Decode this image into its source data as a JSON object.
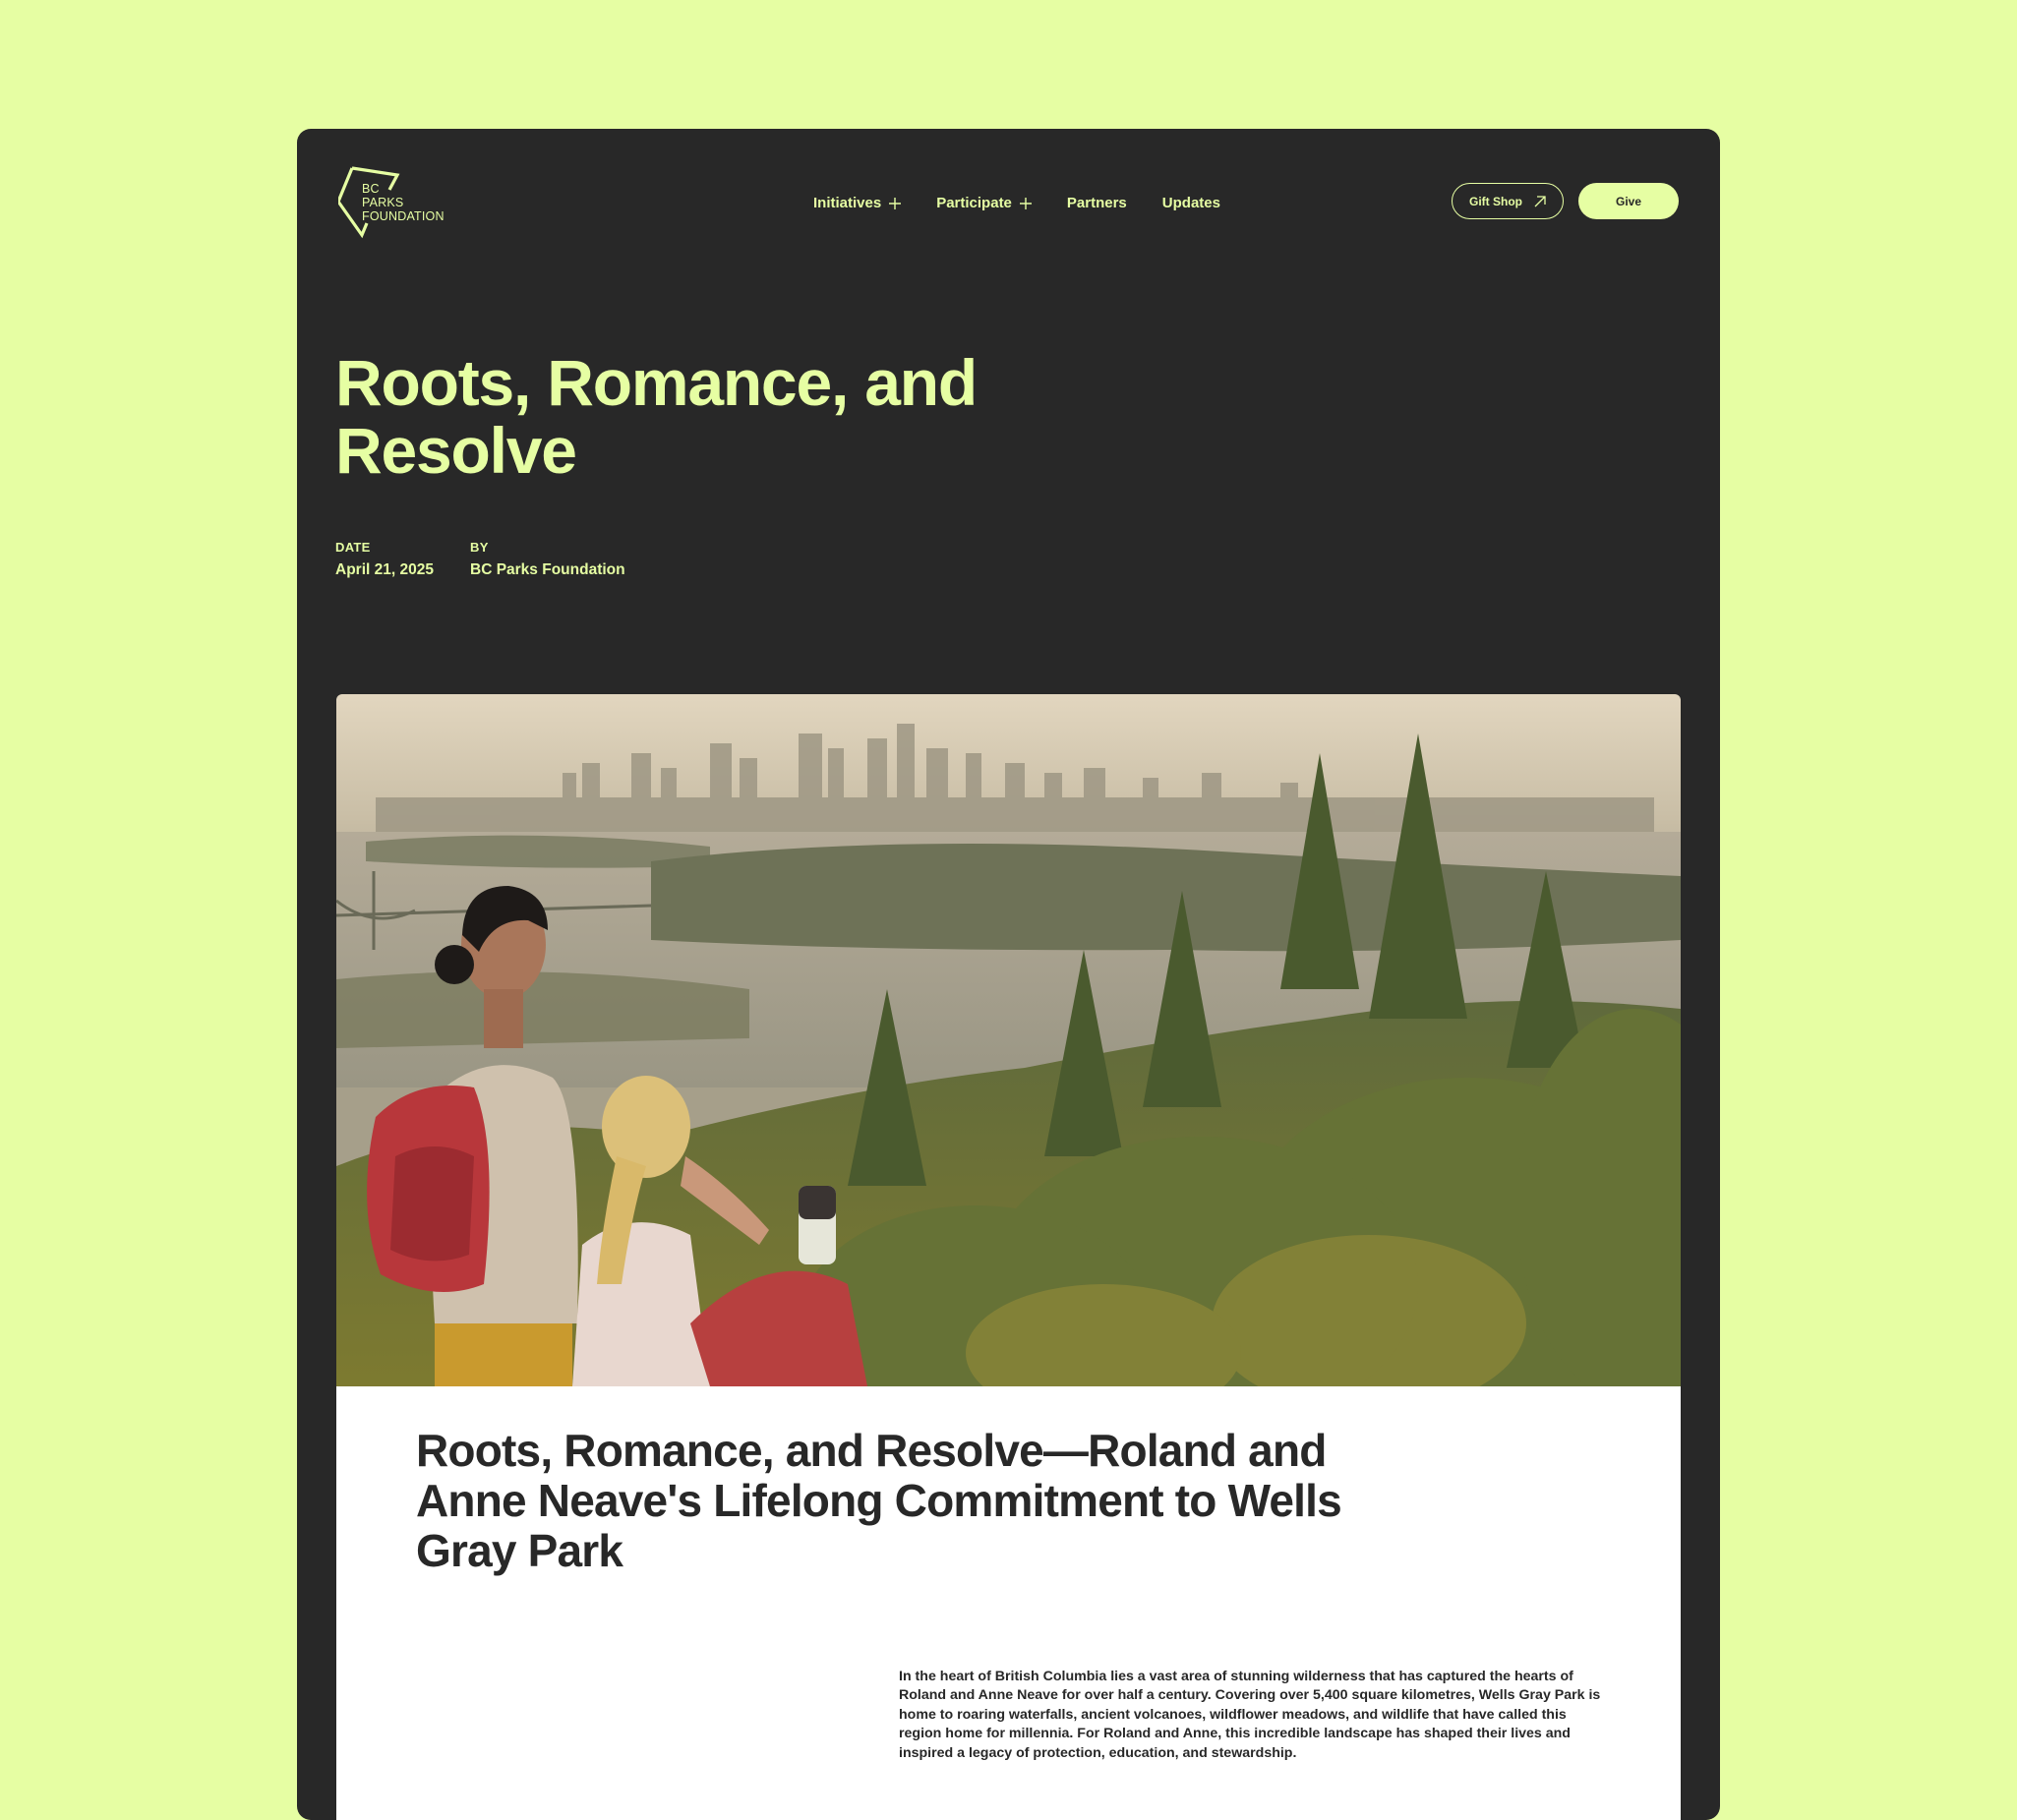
{
  "brand": {
    "name": "BC\nPARKS\nFOUNDATION",
    "accent": "#e6fea3",
    "dark": "#282828"
  },
  "nav": {
    "items": [
      {
        "label": "Initiatives",
        "has_submenu": true
      },
      {
        "label": "Participate",
        "has_submenu": true
      },
      {
        "label": "Partners",
        "has_submenu": false
      },
      {
        "label": "Updates",
        "has_submenu": false
      }
    ]
  },
  "header": {
    "gift_shop_label": "Gift Shop",
    "give_label": "Give"
  },
  "hero": {
    "title": "Roots, Romance, and Resolve",
    "date_label": "DATE",
    "date_value": "April 21, 2025",
    "by_label": "BY",
    "by_value": "BC Parks Foundation"
  },
  "article": {
    "title": "Roots, Romance, and Resolve—Roland and Anne Neave's Lifelong Commitment to Wells Gray Park",
    "body": "In the heart of British Columbia lies a vast area of stunning wilderness that has captured the hearts of Roland and Anne Neave for over half a century.  Covering over 5,400 square kilometres, Wells Gray Park is home to roaring waterfalls, ancient volcanoes, wildflower meadows, and wildlife that have called this region home for millennia.  For Roland and Anne, this incredible landscape has shaped their lives and inspired a legacy of protection, education, and stewardship."
  }
}
